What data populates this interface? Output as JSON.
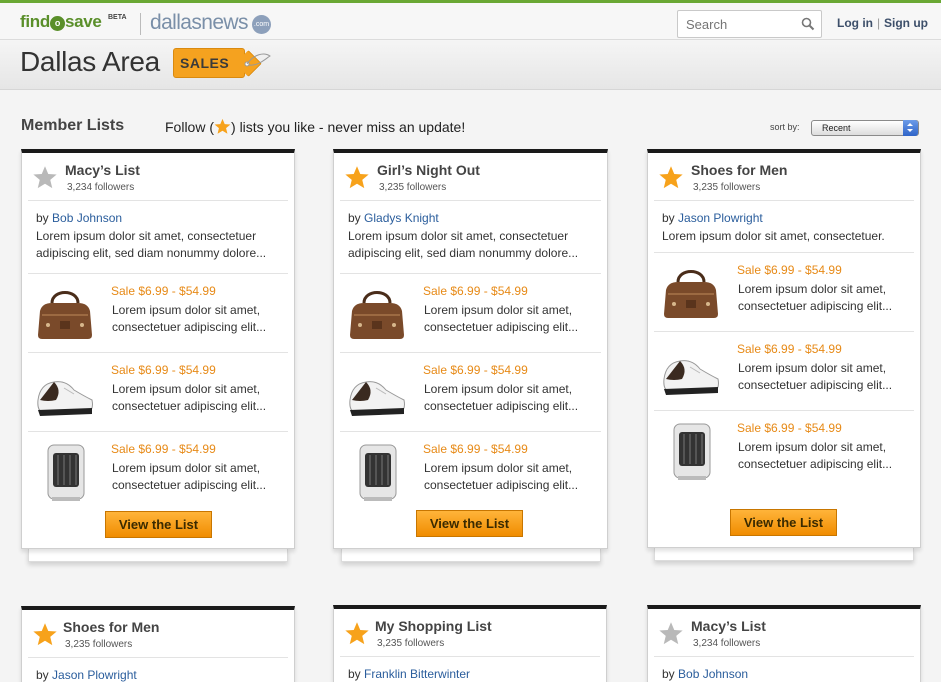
{
  "topbar": {
    "brand_main": "find",
    "brand_o": "o",
    "brand_end": "save",
    "brand_beta": "BETA",
    "partner_name": "dallasnews",
    "partner_badge": ".com",
    "search_placeholder": "Search",
    "login_label": "Log in",
    "separator": "|",
    "signup_label": "Sign up"
  },
  "header": {
    "title": "Dallas Area",
    "tag_label": "SALES"
  },
  "toolbar": {
    "heading": "Member Lists",
    "follow_prefix": "Follow (",
    "follow_suffix": ") lists you like - never miss an update!",
    "sort_label": "sort by:",
    "sort_value": "Recent"
  },
  "colors": {
    "accent_orange": "#f5a21f",
    "price_orange": "#e78a17",
    "link_blue": "#2a5d9c",
    "brand_green": "#5a8f2a",
    "star_active": "#f7a21b",
    "star_inactive": "#b9b9b9"
  },
  "cards": [
    {
      "title": "Macy’s List",
      "followers": "3,234 followers",
      "star": "star-inactive-icon",
      "by": "by ",
      "author": "Bob Johnson",
      "desc1": "Lorem ipsum dolor sit amet, consectetuer",
      "desc2": "adipiscing elit, sed diam nonummy dolore...",
      "items": [
        {
          "price": "Sale $6.99 - $54.99",
          "line1": "Lorem ipsum dolor sit amet,",
          "line2": "consectetuer adipiscing elit...",
          "icon": "handbag-icon"
        },
        {
          "price": "Sale $6.99 - $54.99",
          "line1": "Lorem ipsum dolor sit amet,",
          "line2": "consectetuer adipiscing elit...",
          "icon": "shoe-icon"
        },
        {
          "price": "Sale $6.99 - $54.99",
          "line1": "Lorem ipsum dolor sit amet,",
          "line2": "consectetuer adipiscing elit...",
          "icon": "heater-icon"
        }
      ],
      "button": "View the List"
    },
    {
      "title": "Girl’s Night Out",
      "followers": "3,235 followers",
      "star": "star-active-icon",
      "by": "by ",
      "author": "Gladys Knight",
      "desc1": "Lorem ipsum dolor sit amet, consectetuer",
      "desc2": "adipiscing elit, sed diam nonummy dolore...",
      "items": [
        {
          "price": "Sale $6.99 - $54.99",
          "line1": "Lorem ipsum dolor sit amet,",
          "line2": "consectetuer adipiscing elit...",
          "icon": "handbag-icon"
        },
        {
          "price": "Sale $6.99 - $54.99",
          "line1": "Lorem ipsum dolor sit amet,",
          "line2": "consectetuer adipiscing elit...",
          "icon": "shoe-icon"
        },
        {
          "price": "Sale $6.99 - $54.99",
          "line1": "Lorem ipsum dolor sit amet,",
          "line2": "consectetuer adipiscing elit...",
          "icon": "heater-icon"
        }
      ],
      "button": "View the List"
    },
    {
      "title": "Shoes for Men",
      "followers": "3,235 followers",
      "star": "star-active-icon",
      "by": "by ",
      "author": "Jason Plowright",
      "desc1": "Lorem ipsum dolor sit amet, consectetuer.",
      "desc2": "",
      "items": [
        {
          "price": "Sale $6.99 - $54.99",
          "line1": "Lorem ipsum dolor sit amet,",
          "line2": "consectetuer adipiscing elit...",
          "icon": "handbag-icon"
        },
        {
          "price": "Sale $6.99 - $54.99",
          "line1": "Lorem ipsum dolor sit amet,",
          "line2": "consectetuer adipiscing elit...",
          "icon": "shoe-icon"
        },
        {
          "price": "Sale $6.99 - $54.99",
          "line1": "Lorem ipsum dolor sit amet,",
          "line2": "consectetuer adipiscing elit...",
          "icon": "heater-icon"
        }
      ],
      "button": "View the List"
    },
    {
      "title": "Shoes for Men",
      "followers": "3,235 followers",
      "star": "star-active-icon",
      "by": "by ",
      "author": "Jason Plowright"
    },
    {
      "title": "My Shopping List",
      "followers": "3,235 followers",
      "star": "star-active-icon",
      "by": "by ",
      "author": "Franklin Bitterwinter"
    },
    {
      "title": "Macy’s List",
      "followers": "3,234 followers",
      "star": "star-inactive-icon",
      "by": "by ",
      "author": "Bob Johnson"
    }
  ]
}
